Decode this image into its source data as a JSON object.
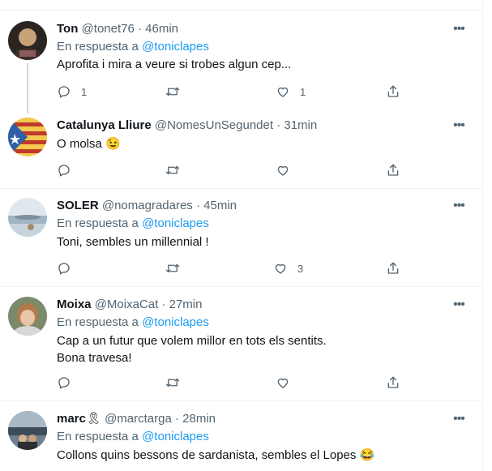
{
  "reply_prefix": "En respuesta a",
  "tweets": [
    {
      "name": "Ton",
      "handle": "@tonet76",
      "time": "46min",
      "reply_to": "@toniclapes",
      "lines": [
        "Aprofita i mira a veure si trobes algun cep..."
      ],
      "replies": "1",
      "retweets": "",
      "likes": "1",
      "has_thread_line": true
    },
    {
      "name": "Catalunya Lliure",
      "handle": "@NomesUnSegundet",
      "time": "31min",
      "reply_to": "",
      "lines": [
        "O molsa 😉"
      ],
      "replies": "",
      "retweets": "",
      "likes": ""
    },
    {
      "name": "SOLER",
      "handle": "@nomagradares",
      "time": "45min",
      "reply_to": "@toniclapes",
      "lines": [
        "Toni, sembles un millennial !"
      ],
      "replies": "",
      "retweets": "",
      "likes": "3"
    },
    {
      "name": "Moixa",
      "handle": "@MoixaCat",
      "time": "27min",
      "reply_to": "@toniclapes",
      "lines": [
        "Cap a un futur que volem millor en tots els sentits.",
        "Bona travesa!"
      ],
      "replies": "",
      "retweets": "",
      "likes": ""
    },
    {
      "name": "marc",
      "name_badge": "🎗",
      "handle": "@marctarga",
      "time": "28min",
      "reply_to": "@toniclapes",
      "lines": [
        "Collons quins bessons de sardanista, sembles el Lopes 😂"
      ],
      "replies": "",
      "retweets": "",
      "likes": ""
    }
  ],
  "separator": "·",
  "more_icon": "more-horizontal-icon",
  "action_icons": [
    "reply-icon",
    "retweet-icon",
    "like-icon",
    "share-icon"
  ],
  "colors": {
    "link": "#1d9bf0",
    "secondary": "#536471",
    "text": "#0f1419",
    "border": "#eff3f4"
  }
}
